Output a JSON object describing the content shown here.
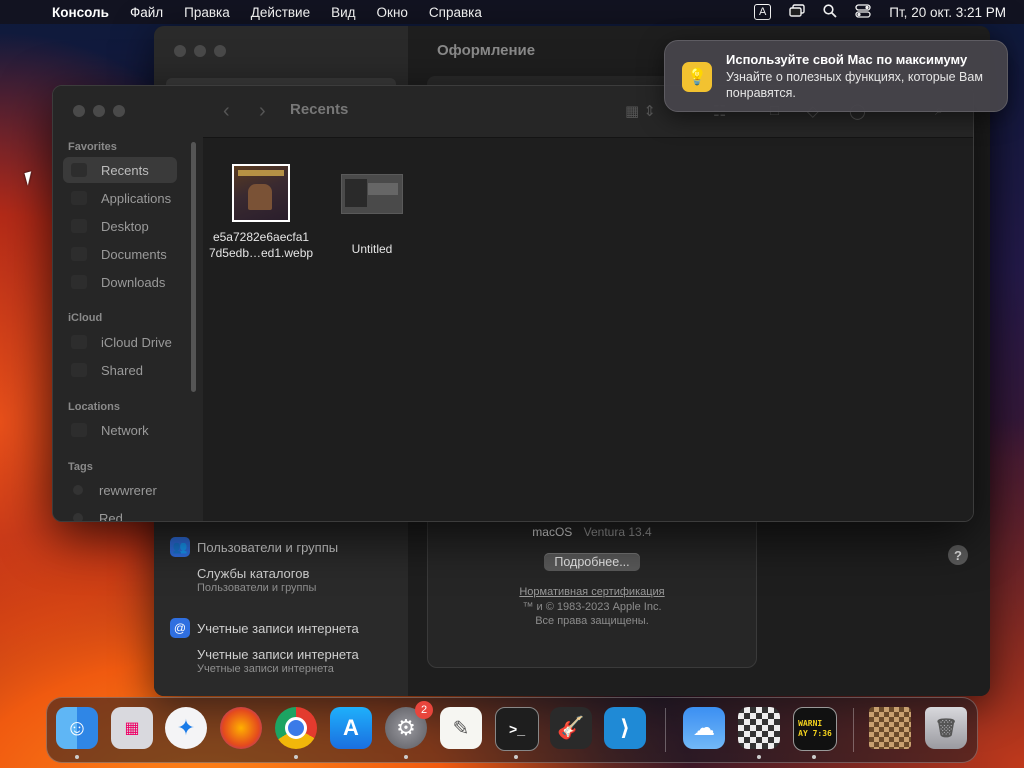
{
  "menubar": {
    "app": "Консоль",
    "items": [
      "Файл",
      "Правка",
      "Действие",
      "Вид",
      "Окно",
      "Справка"
    ],
    "input_source": "A",
    "datetime": "Пт, 20 окт.  3:21 PM"
  },
  "settings": {
    "title": "Оформление",
    "sidebar": [
      {
        "label": "Пользователи и группы",
        "icon": "users-icon"
      },
      {
        "label": "Службы каталогов",
        "sub": "Пользователи и группы"
      },
      {
        "label": "Учетные записи интернета",
        "icon": "at-icon"
      },
      {
        "label": "Учетные записи интернета",
        "sub": "Учетные записи интернета"
      }
    ],
    "about": {
      "os_name": "macOS",
      "os_version": "Ventura 13.4",
      "more_button": "Подробнее...",
      "cert_link": "Нормативная сертификация",
      "copyright": "™ и © 1983-2023 Apple Inc.",
      "rights": "Все права защищены."
    },
    "help": "?"
  },
  "finder": {
    "title": "Recents",
    "sections": {
      "favorites": "Favorites",
      "icloud": "iCloud",
      "locations": "Locations",
      "tags": "Tags"
    },
    "favorites": [
      "Recents",
      "Applications",
      "Desktop",
      "Documents",
      "Downloads"
    ],
    "icloud": [
      "iCloud Drive",
      "Shared"
    ],
    "locations": [
      "Network"
    ],
    "tags": [
      "rewwrerer",
      "Red"
    ],
    "files": [
      {
        "name_line1": "e5a7282e6aecfa1",
        "name_line2": "7d5edb…ed1.webp"
      },
      {
        "name_line1": "Untitled",
        "name_line2": ""
      }
    ]
  },
  "notification": {
    "title": "Используйте свой Mac по максимуму",
    "body": "Узнайте о полезных функциях, которые Вам понравятся."
  },
  "dock": {
    "settings_badge": "2",
    "console_text": "WARNI\nAY 7:36",
    "apps": [
      "finder-icon",
      "launchpad-icon",
      "safari-icon",
      "firefox-icon",
      "chrome-icon",
      "app-store-icon",
      "system-settings-icon",
      "textedit-icon",
      "terminal-icon",
      "garageband-icon",
      "vscode-icon",
      "weather-icon",
      "chess-icon",
      "console-icon",
      "chess-window-icon",
      "trash-icon"
    ]
  },
  "colors": {
    "accent": "#2f6fe0",
    "notif_icon": "#f2c230",
    "badge": "#e8453c"
  }
}
